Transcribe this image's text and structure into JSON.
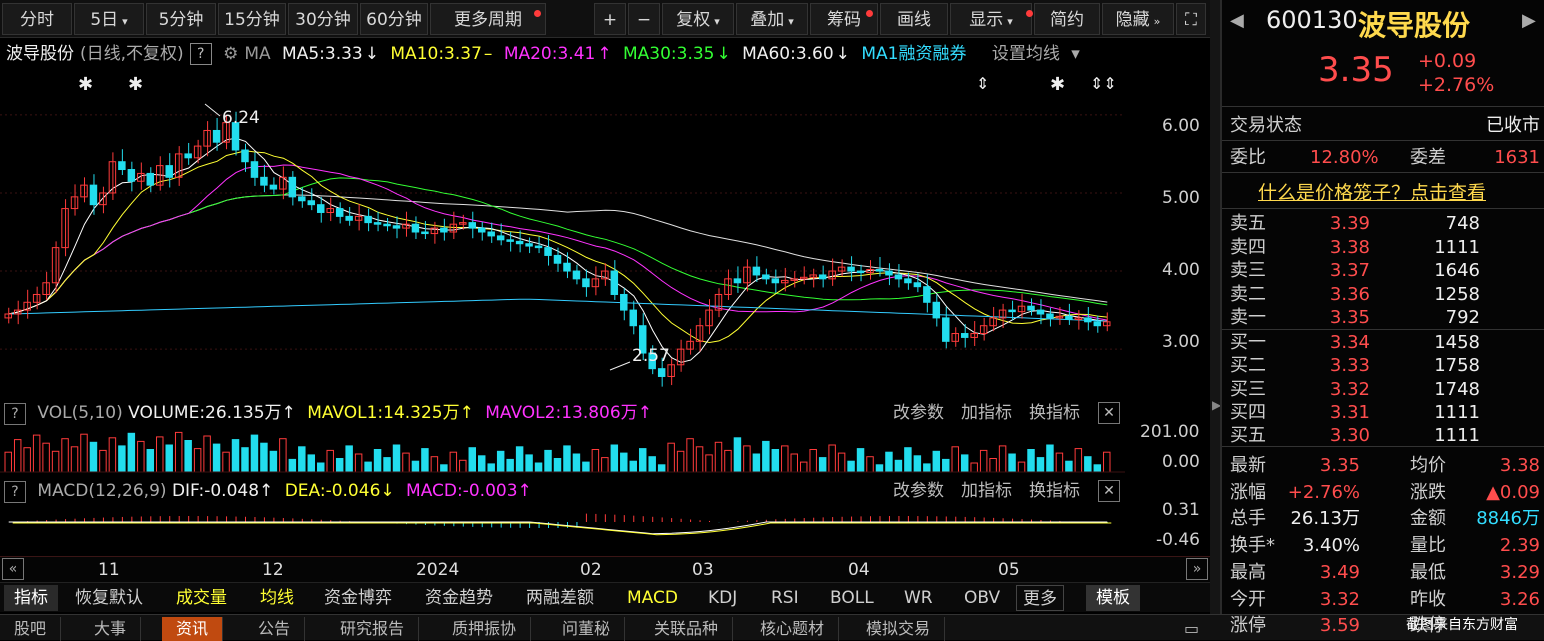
{
  "toolbar": {
    "tabs": [
      "分时",
      "5日",
      "5分钟",
      "15分钟",
      "30分钟",
      "60分钟",
      "更多周期"
    ],
    "tools": [
      "+",
      "−",
      "复权",
      "叠加",
      "筹码",
      "画线",
      "显示",
      "简约",
      "隐藏"
    ]
  },
  "header": {
    "name": "波导股份",
    "mode": "(日线,不复权)",
    "ma_label": "MA",
    "ma5": "MA5:3.33",
    "ma10": "MA10:3.37",
    "ma20": "MA20:3.41",
    "ma30": "MA30:3.35",
    "ma60": "MA60:3.60",
    "ma1": "MA1融资融券",
    "setting": "设置均线"
  },
  "chart_data": {
    "type": "candlestick",
    "y_ticks": [
      "6.00",
      "5.00",
      "4.00",
      "3.00"
    ],
    "ylim": [
      2.4,
      6.6
    ],
    "high_annot": "6.24",
    "low_annot": "2.57",
    "x_ticks": [
      "11",
      "12",
      "2024",
      "02",
      "03",
      "04",
      "05"
    ],
    "vol_ticks": [
      "201.00",
      "0.00"
    ],
    "macd_ticks": [
      "0.31",
      "-0.46"
    ],
    "close": [
      3.45,
      3.5,
      3.6,
      3.7,
      3.85,
      4.3,
      4.8,
      4.95,
      5.1,
      4.85,
      5.0,
      5.4,
      5.3,
      5.15,
      5.25,
      5.1,
      5.35,
      5.2,
      5.5,
      5.45,
      5.6,
      5.8,
      5.65,
      5.9,
      5.55,
      5.4,
      5.2,
      5.1,
      5.05,
      5.2,
      4.95,
      4.9,
      4.85,
      4.75,
      4.8,
      4.7,
      4.65,
      4.7,
      4.62,
      4.6,
      4.58,
      4.55,
      4.6,
      4.5,
      4.48,
      4.55,
      4.5,
      4.6,
      4.62,
      4.55,
      4.5,
      4.45,
      4.4,
      4.38,
      4.35,
      4.32,
      4.3,
      4.2,
      4.1,
      4.0,
      3.9,
      3.8,
      3.9,
      4.0,
      3.7,
      3.5,
      3.3,
      2.95,
      2.75,
      2.65,
      2.8,
      3.0,
      3.1,
      3.3,
      3.5,
      3.7,
      3.9,
      3.85,
      4.05,
      3.95,
      3.9,
      3.85,
      3.88,
      3.9,
      3.92,
      3.95,
      3.9,
      4.0,
      4.05,
      4.0,
      3.98,
      4.02,
      4.0,
      3.95,
      3.9,
      3.85,
      3.8,
      3.6,
      3.4,
      3.1,
      3.2,
      3.15,
      3.2,
      3.3,
      3.4,
      3.5,
      3.48,
      3.55,
      3.5,
      3.45,
      3.4,
      3.42,
      3.38,
      3.4,
      3.35,
      3.3,
      3.35
    ]
  },
  "vol": {
    "label": "VOL(5,10)",
    "volume": "VOLUME:26.135万",
    "mavol1": "MAVOL1:14.325万",
    "mavol2": "MAVOL2:13.806万"
  },
  "macd": {
    "label": "MACD(12,26,9)",
    "dif": "DIF:-0.048",
    "dea": "DEA:-0.046",
    "macd": "MACD:-0.003"
  },
  "sub_actions": [
    "改参数",
    "加指标",
    "换指标"
  ],
  "indicator_tabs": [
    "指标",
    "恢复默认",
    "成交量",
    "均线",
    "资金博弈",
    "资金趋势",
    "两融差额",
    "MACD",
    "KDJ",
    "RSI",
    "BOLL",
    "WR",
    "OBV",
    "更多",
    "模板"
  ],
  "bottom_tabs": [
    "股吧",
    "大事",
    "资讯",
    "公告",
    "研究报告",
    "质押振协",
    "问董秘",
    "关联品种",
    "核心题材",
    "模拟交易"
  ],
  "quote": {
    "code": "600130",
    "name": "波导股份",
    "price": "3.35",
    "chg": "+0.09",
    "pct": "+2.76%",
    "status_label": "交易状态",
    "status": "已收市",
    "wb_label": "委比",
    "wb": "12.80%",
    "wc_label": "委差",
    "wc": "1631",
    "cage": "什么是价格笼子？点击查看",
    "asks": [
      [
        "卖五",
        "3.39",
        "748"
      ],
      [
        "卖四",
        "3.38",
        "1111"
      ],
      [
        "卖三",
        "3.37",
        "1646"
      ],
      [
        "卖二",
        "3.36",
        "1258"
      ],
      [
        "卖一",
        "3.35",
        "792"
      ]
    ],
    "bids": [
      [
        "买一",
        "3.34",
        "1458"
      ],
      [
        "买二",
        "3.33",
        "1758"
      ],
      [
        "买三",
        "3.32",
        "1748"
      ],
      [
        "买四",
        "3.31",
        "1111"
      ],
      [
        "买五",
        "3.30",
        "1111"
      ]
    ],
    "stats": [
      [
        "最新",
        "3.35",
        "均价",
        "3.38"
      ],
      [
        "涨幅",
        "+2.76%",
        "涨跌",
        "▲0.09"
      ],
      [
        "总手",
        "26.13万",
        "金额",
        "8846万"
      ],
      [
        "换手*",
        "3.40%",
        "量比",
        "2.39"
      ],
      [
        "最高",
        "3.49",
        "最低",
        "3.29"
      ],
      [
        "今开",
        "3.32",
        "昨收",
        "3.26"
      ],
      [
        "涨停",
        "3.59",
        "跌停",
        ""
      ]
    ],
    "watermark": "截图来自东方财富"
  }
}
